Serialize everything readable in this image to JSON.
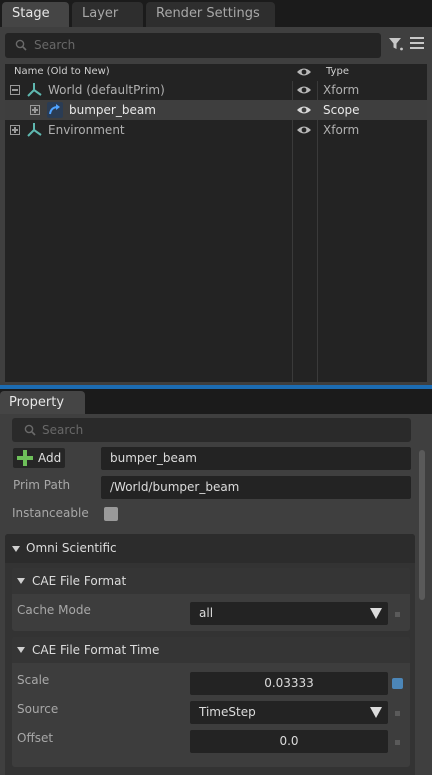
{
  "stage": {
    "tabs": [
      {
        "label": "Stage"
      },
      {
        "label": "Layer"
      },
      {
        "label": "Render Settings"
      }
    ],
    "search_placeholder": "Search",
    "columns": {
      "name": "Name (Old to New)",
      "visibility": "eye-icon",
      "type": "Type"
    },
    "rows": [
      {
        "label": "World (defaultPrim)",
        "type": "Xform",
        "icon": "xform-axis-icon",
        "expander": "collapse",
        "selected": false
      },
      {
        "label": "bumper_beam",
        "type": "Scope",
        "icon": "scope-reference-icon",
        "expander": "expand",
        "selected": true
      },
      {
        "label": "Environment",
        "type": "Xform",
        "icon": "xform-axis-icon",
        "expander": "expand",
        "selected": false
      }
    ]
  },
  "property": {
    "tab_label": "Property",
    "search_placeholder": "Search",
    "add_label": "Add",
    "prim_name": "bumper_beam",
    "prim_path_label": "Prim Path",
    "prim_path": "/World/bumper_beam",
    "instanceable_label": "Instanceable",
    "instanceable": false,
    "section": {
      "title": "Omni Scientific",
      "subsections": [
        {
          "title": "CAE File Format",
          "cache_mode_label": "Cache Mode",
          "cache_mode_value": "all"
        },
        {
          "title": "CAE File Format Time",
          "scale_label": "Scale",
          "scale_value": "0.03333",
          "source_label": "Source",
          "source_value": "TimeStep",
          "offset_label": "Offset",
          "offset_value": "0.0"
        }
      ]
    }
  },
  "colors": {
    "accent": "#1c6cb3",
    "add_plus": "#6ec05a",
    "xform_icon": "#5fb8b0",
    "scope_icon": "#3d8fe0"
  }
}
